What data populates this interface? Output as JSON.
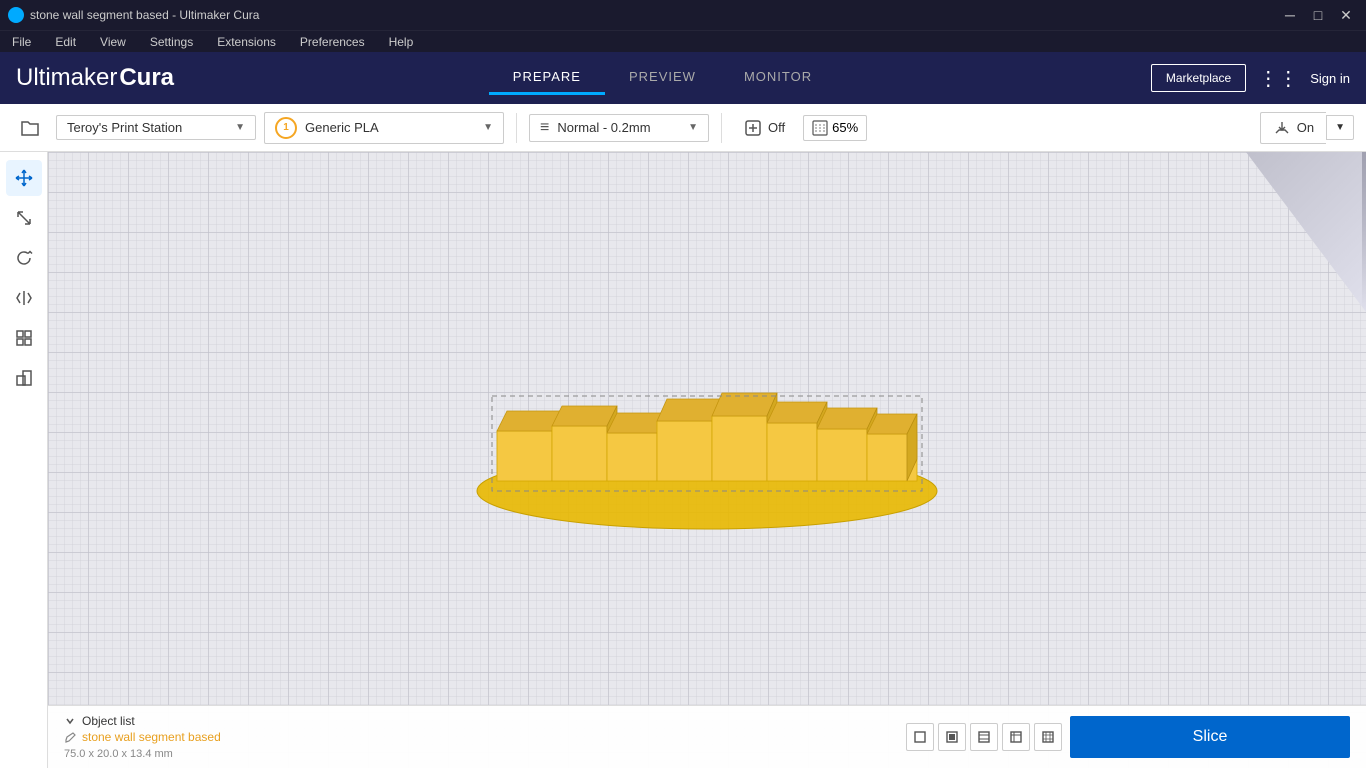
{
  "titlebar": {
    "title": "stone wall segment based - Ultimaker Cura",
    "icon": "●",
    "controls": {
      "minimize": "─",
      "maximize": "□",
      "close": "✕"
    }
  },
  "menubar": {
    "items": [
      "File",
      "Edit",
      "View",
      "Settings",
      "Extensions",
      "Preferences",
      "Help"
    ]
  },
  "header": {
    "logo_light": "Ultimaker",
    "logo_bold": " Cura",
    "nav": [
      {
        "label": "PREPARE",
        "active": true
      },
      {
        "label": "PREVIEW",
        "active": false
      },
      {
        "label": "MONITOR",
        "active": false
      }
    ],
    "marketplace_label": "Marketplace",
    "signin_label": "Sign in"
  },
  "toolbar": {
    "printer": "Teroy's Print Station",
    "material_number": "1",
    "material_name": "Generic PLA",
    "settings_label": "Normal - 0.2mm",
    "support_icon_label": "⚙",
    "support_off_label": "Off",
    "percentage": "65%",
    "save_label": "On"
  },
  "tools": [
    {
      "name": "move",
      "icon": "✛"
    },
    {
      "name": "scale",
      "icon": "⤢"
    },
    {
      "name": "rotate",
      "icon": "↺"
    },
    {
      "name": "mirror",
      "icon": "⊣"
    },
    {
      "name": "arrange",
      "icon": "⊞"
    },
    {
      "name": "per-model",
      "icon": "⊿"
    }
  ],
  "bottom": {
    "object_list_label": "Object list",
    "object_name": "stone wall segment based",
    "object_dims": "75.0 x 20.0 x 13.4 mm",
    "shapes": [
      "□",
      "▣",
      "▤",
      "▦",
      "▩"
    ],
    "slice_label": "Slice"
  },
  "colors": {
    "header_bg": "#1e2151",
    "accent_blue": "#0066cc",
    "model_yellow": "#f5c842",
    "nav_active": "#00aaff"
  }
}
